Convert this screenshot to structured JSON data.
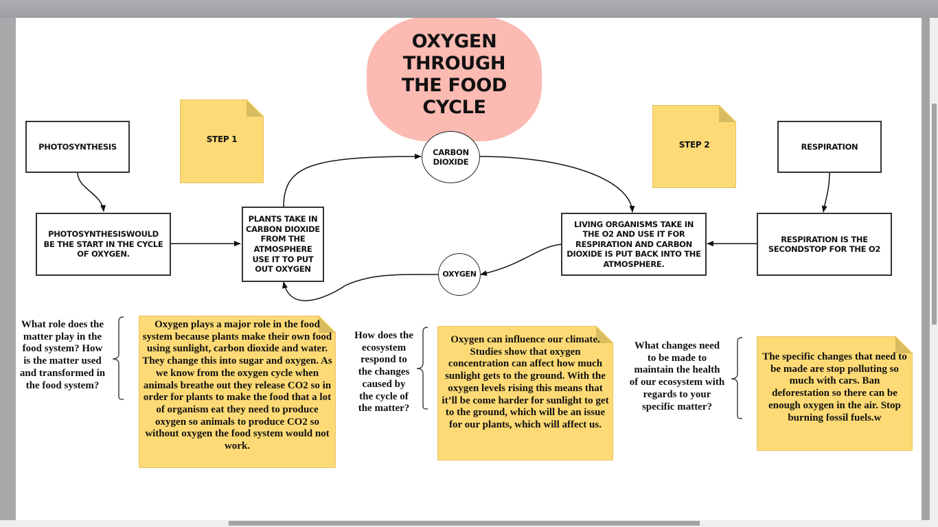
{
  "diagram": {
    "title": "OXYGEN THROUGH THE FOOD CYCLE",
    "nodes": {
      "photosynthesis": "PHOTOSYNTHESIS",
      "photosynthesis_desc": "PHOTOSYNTHESISWOULD BE THE START IN THE CYCLE OF OXYGEN.",
      "plants": "PLANTS TAKE IN CARBON DIOXIDE FROM THE ATMOSPHERE USE IT TO PUT OUT OXYGEN",
      "carbon_dioxide": "CARBON DIOXIDE",
      "oxygen": "OXYGEN",
      "living_organisms": "LIVING ORGANISMS TAKE IN THE O2 AND USE IT FOR RESPIRATION  AND CARBON DIOXIDE IS PUT BACK INTO THE ATMOSPHERE.",
      "respiration": "RESPIRATION",
      "respiration_desc": "RESPIRATION IS THE SECONDSTOP FOR THE O2"
    },
    "steps": [
      "STEP 1",
      "STEP 2"
    ],
    "colors": {
      "title_fill": "#fbbab2",
      "note_fill": "#fdda75",
      "note_fold": "#d9bc5f"
    }
  },
  "qa": [
    {
      "question": "What role does the matter play in the food system? How is the matter used and transformed in the food system?",
      "answer": "Oxygen plays a major role in the food system because plants make their own food using sunlight, carbon dioxide and water. They change this into sugar and oxygen. As we know from the oxygen cycle when animals breathe out they release CO2 so in order for plants to make the food that a lot of organism eat they need to produce oxygen so animals to produce CO2 so without oxygen the food system would not work."
    },
    {
      "question": "How does the ecosystem respond to the changes caused by the cycle of the matter?",
      "answer": "Oxygen can influence our climate. Studies show that oxygen concentration can affect how much sunlight gets to the ground. With the oxygen levels rising this means that it’ll be come harder for sunlight to get to the ground, which will be an issue for our plants, which will affect us."
    },
    {
      "question": "What changes need to be made to maintain the health of our ecosystem with regards to your specific matter?",
      "answer": "The specific changes that need to be made are stop polluting so much with cars. Ban deforestation so there can be enough oxygen in the air. Stop burning fossil fuels.w"
    }
  ]
}
